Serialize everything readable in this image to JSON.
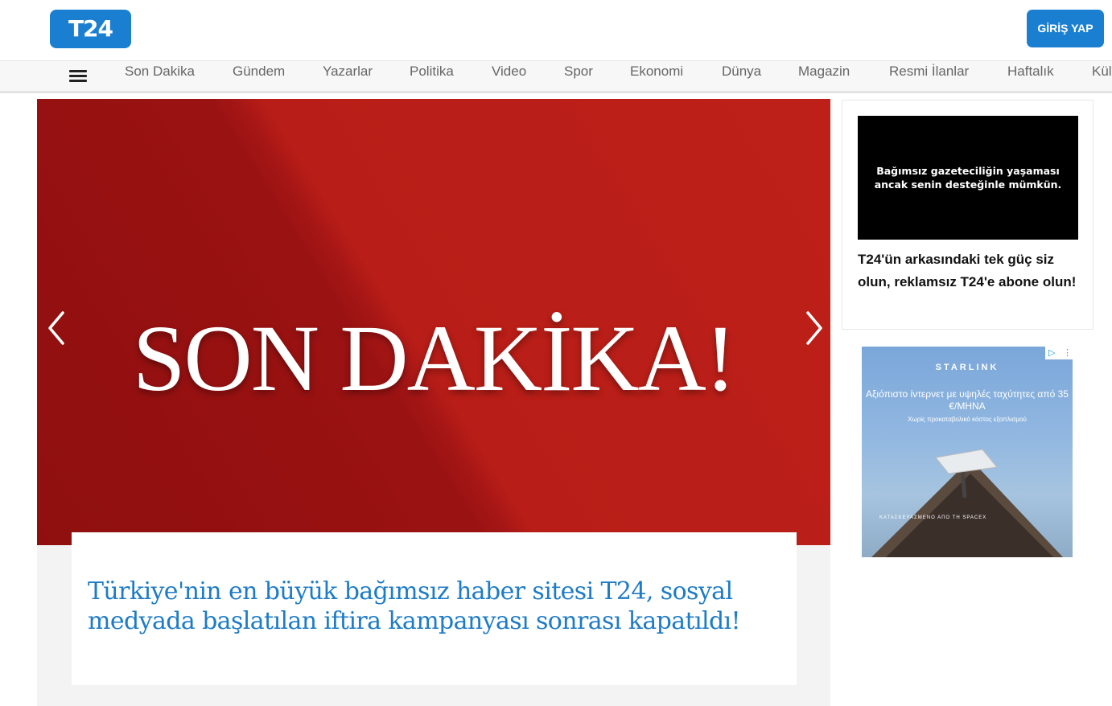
{
  "header": {
    "logo": "T24",
    "login_label": "GİRİŞ YAP"
  },
  "nav": {
    "items": [
      "Son Dakika",
      "Gündem",
      "Yazarlar",
      "Politika",
      "Video",
      "Spor",
      "Ekonomi",
      "Dünya",
      "Magazin",
      "Resmi İlanlar",
      "Haftalık",
      "Kül"
    ]
  },
  "hero": {
    "title": "SON DAKİKA!",
    "headline": "Türkiye'nin en büyük bağımsız haber sitesi T24, sosyal medyada başlatılan iftira kampanyası sonrası kapatıldı!"
  },
  "sidebar": {
    "promo_banner": "Bağımsız gazeteciliğin yaşaması ancak senin desteğinle mümkün.",
    "promo_text": "T24'ün arkasındaki tek güç siz olun, reklamsız T24'e abone olun!"
  },
  "ad": {
    "brand": "STARLINK",
    "line1": "Αξιόπιστο ίντερνετ με υψηλές ταχύτητες από 35 €/ΜΗΝΑ",
    "line2": "Χωρίς προκαταβολικό κόστος εξοπλισμού",
    "footer": "ΚΑΤΑΣΚΕΥΑΣΜΕΝΟ ΑΠΟ ΤΗ SPACEX"
  },
  "colors": {
    "brand_blue": "#1a7fd1",
    "hero_red": "#b81d17",
    "headline_blue": "#1d7bc7"
  }
}
